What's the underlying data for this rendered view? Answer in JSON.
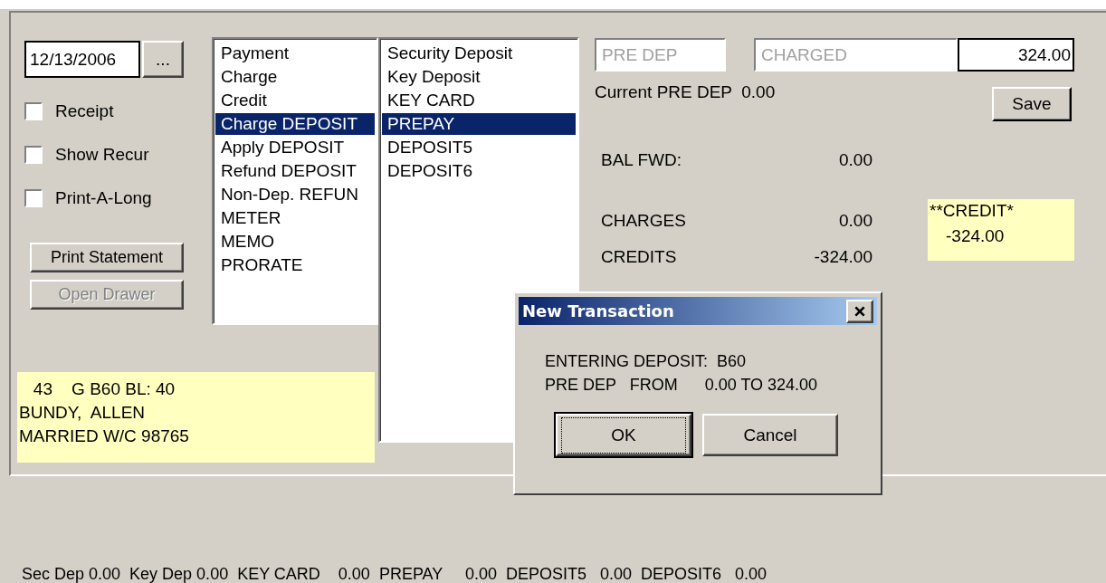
{
  "date_field": {
    "value": "12/13/2006",
    "button": "..."
  },
  "checkboxes": [
    {
      "label": "Receipt",
      "checked": false
    },
    {
      "label": "Show Recur",
      "checked": false
    },
    {
      "label": "Print-A-Long",
      "checked": false
    }
  ],
  "buttons": [
    {
      "label": "Print Statement",
      "disabled": false
    },
    {
      "label": "Open Drawer",
      "disabled": true
    }
  ],
  "transaction_types": [
    {
      "label": "Payment",
      "selected": false
    },
    {
      "label": "Charge",
      "selected": false
    },
    {
      "label": "Credit",
      "selected": false
    },
    {
      "label": "Charge DEPOSIT",
      "selected": true
    },
    {
      "label": "Apply DEPOSIT",
      "selected": false
    },
    {
      "label": "Refund DEPOSIT",
      "selected": false
    },
    {
      "label": "Non-Dep. REFUN",
      "selected": false
    },
    {
      "label": "METER",
      "selected": false
    },
    {
      "label": "MEMO",
      "selected": false
    },
    {
      "label": "PRORATE",
      "selected": false
    }
  ],
  "deposit_types": [
    {
      "label": "Security Deposit",
      "selected": false
    },
    {
      "label": "Key Deposit",
      "selected": false
    },
    {
      "label": "KEY CARD",
      "selected": false
    },
    {
      "label": "PREPAY",
      "selected": true
    },
    {
      "label": "DEPOSIT5",
      "selected": false
    },
    {
      "label": "DEPOSIT6",
      "selected": false
    }
  ],
  "tenant_info": [
    "   43    G B60 BL: 40",
    "BUNDY,  ALLEN",
    "MARRIED W/C 98765"
  ],
  "fields": [
    {
      "placeholder": "PRE DEP"
    },
    {
      "placeholder": "CHARGED"
    },
    {
      "value": "324.00"
    }
  ],
  "current_deposit": "Current PRE DEP  0.00",
  "save_button": "Save",
  "balance_forward": {
    "label": "BAL FWD:",
    "value": "0.00"
  },
  "totals": [
    {
      "label": "CHARGES",
      "value": "0.00"
    },
    {
      "label": "CREDITS",
      "value": "-324.00"
    }
  ],
  "credit_box": {
    "label": "**CREDIT*",
    "value": "-324.00"
  },
  "dialog": {
    "title": "New Transaction",
    "lines": [
      "ENTERING DEPOSIT:  B60",
      "PRE DEP   FROM      0.00 TO 324.00"
    ],
    "buttons": [
      {
        "label": "OK",
        "focused": true
      },
      {
        "label": "Cancel",
        "focused": false
      }
    ]
  },
  "status_line": "Sec Dep 0.00  Key Dep 0.00  KEY CARD    0.00  PREPAY     0.00  DEPOSIT5   0.00  DEPOSIT6   0.00"
}
